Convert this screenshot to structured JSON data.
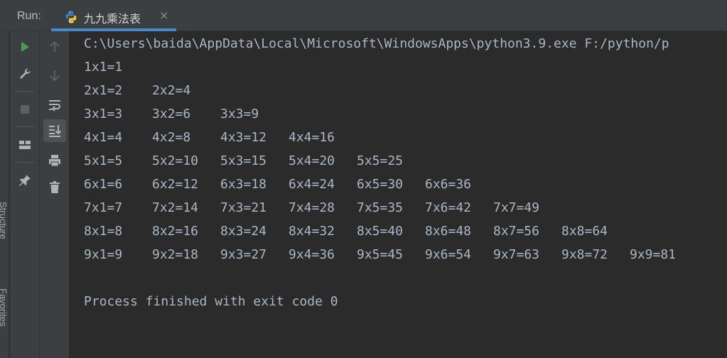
{
  "run_bar": {
    "label": "Run:",
    "tab": {
      "title": "九九乘法表",
      "close": "×",
      "icon": "python-icon"
    }
  },
  "side_strip": {
    "structure_label": "Structure",
    "favorites_label": "Favorites"
  },
  "toolbar_left": {
    "items": [
      {
        "name": "run-icon",
        "active": false
      },
      {
        "name": "wrench-icon",
        "active": false
      },
      {
        "name": "stop-icon",
        "active": false
      },
      {
        "name": "layout-icon",
        "active": false
      },
      {
        "name": "pin-icon",
        "active": false
      }
    ]
  },
  "toolbar_right": {
    "items": [
      {
        "name": "arrow-up-icon",
        "active": false
      },
      {
        "name": "arrow-down-icon",
        "active": false
      },
      {
        "name": "soft-wrap-icon",
        "active": false
      },
      {
        "name": "scroll-to-end-icon",
        "active": true
      },
      {
        "name": "print-icon",
        "active": false
      },
      {
        "name": "trash-icon",
        "active": false
      }
    ]
  },
  "console": {
    "command": "C:\\Users\\baida\\AppData\\Local\\Microsoft\\WindowsApps\\python3.9.exe F:/python/p",
    "rows": [
      [
        "1x1=1"
      ],
      [
        "2x1=2",
        "2x2=4"
      ],
      [
        "3x1=3",
        "3x2=6",
        "3x3=9"
      ],
      [
        "4x1=4",
        "4x2=8",
        "4x3=12",
        "4x4=16"
      ],
      [
        "5x1=5",
        "5x2=10",
        "5x3=15",
        "5x4=20",
        "5x5=25"
      ],
      [
        "6x1=6",
        "6x2=12",
        "6x3=18",
        "6x4=24",
        "6x5=30",
        "6x6=36"
      ],
      [
        "7x1=7",
        "7x2=14",
        "7x3=21",
        "7x4=28",
        "7x5=35",
        "7x6=42",
        "7x7=49"
      ],
      [
        "8x1=8",
        "8x2=16",
        "8x3=24",
        "8x4=32",
        "8x5=40",
        "8x6=48",
        "8x7=56",
        "8x8=64"
      ],
      [
        "9x1=9",
        "9x2=18",
        "9x3=27",
        "9x4=36",
        "9x5=45",
        "9x6=54",
        "9x7=63",
        "9x8=72",
        "9x9=81"
      ]
    ],
    "exit_message": "Process finished with exit code 0"
  },
  "colors": {
    "background": "#2b2b2b",
    "toolbar": "#3c3f41",
    "text": "#a9b7c6",
    "run_green": "#499c54",
    "icon_gray": "#afb1b3",
    "tab_accent": "#4a88c7"
  }
}
